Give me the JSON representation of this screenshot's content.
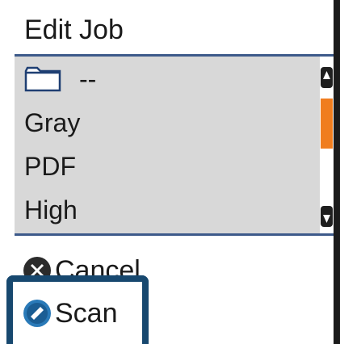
{
  "header": {
    "title": "Edit Job"
  },
  "list": {
    "items": [
      {
        "label": "--",
        "icon": "folder-icon"
      },
      {
        "label": "Gray"
      },
      {
        "label": "PDF"
      },
      {
        "label": "High"
      }
    ],
    "scroll_position": 0.25
  },
  "footer": {
    "cancel_label": "Cancel",
    "scan_label": "Scan"
  },
  "colors": {
    "header_rule": "#3d5a8a",
    "list_background": "#d8d8d8",
    "scroll_thumb": "#f07d1e",
    "focus_frame": "#17486f",
    "scan_button": "#2a7ab8"
  }
}
